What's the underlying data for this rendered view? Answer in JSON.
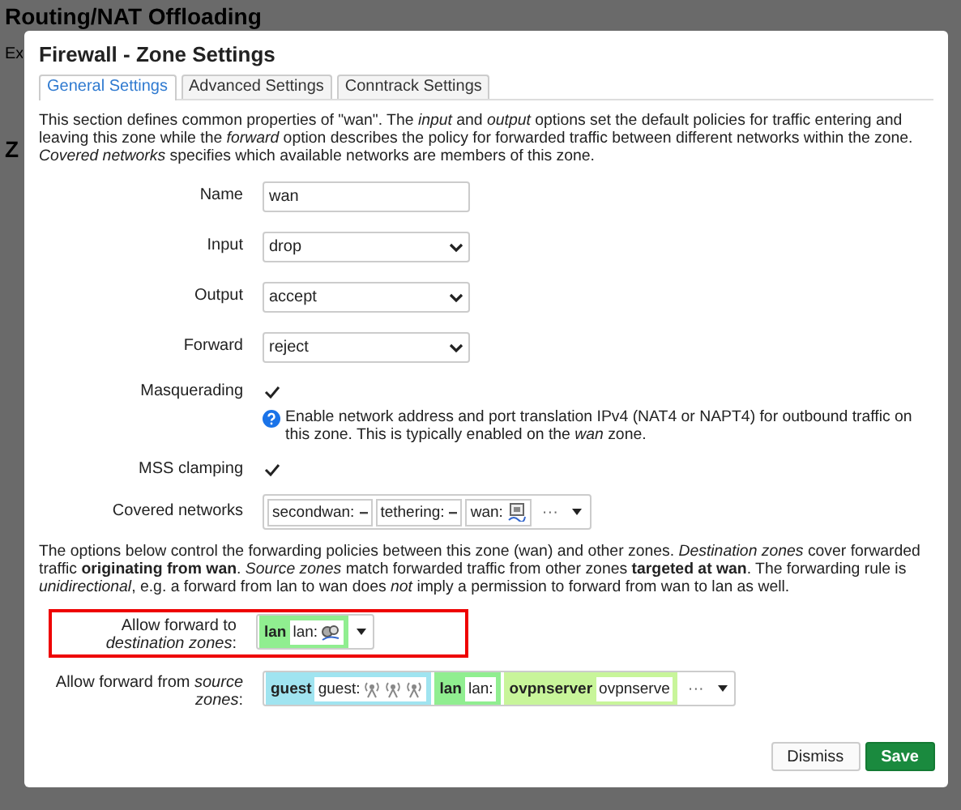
{
  "background": {
    "heading": "Routing/NAT Offloading",
    "intro": "Ex",
    "section": "Z"
  },
  "modal": {
    "title": "Firewall - Zone Settings",
    "tabs": [
      {
        "label": "General Settings",
        "selected": true
      },
      {
        "label": "Advanced Settings",
        "selected": false
      },
      {
        "label": "Conntrack Settings",
        "selected": false
      }
    ],
    "description": "This section defines common properties of \"wan\". The *input* and *output* options set the default policies for traffic entering and leaving this zone while the *forward* option describes the policy for forwarded traffic between different networks within the zone. *Covered networks* specifies which available networks are members of this zone.",
    "fields": [
      {
        "kind": "text",
        "label": "Name",
        "value": "wan"
      },
      {
        "kind": "select",
        "label": "Input",
        "value": "drop"
      },
      {
        "kind": "select",
        "label": "Output",
        "value": "accept"
      },
      {
        "kind": "select",
        "label": "Forward",
        "value": "reject"
      },
      {
        "kind": "checkbox",
        "label": "Masquerading",
        "checked": true,
        "help": "Enable network address and port translation IPv4 (NAT4 or NAPT4) for outbound traffic on this zone. This is typically enabled on the *wan* zone."
      },
      {
        "kind": "checkbox",
        "label": "MSS clamping",
        "checked": true
      },
      {
        "kind": "networks",
        "label": "Covered networks",
        "chips": [
          {
            "text": "secondwan:",
            "kind": "dash"
          },
          {
            "text": "tethering:",
            "kind": "dash"
          },
          {
            "text": "wan:",
            "kind": "device"
          }
        ],
        "more": "···"
      }
    ],
    "forwarding_description": "The options below control the forwarding policies between this zone (wan) and other zones. *Destination zones* cover forwarded traffic **originating from wan**. *Source zones* match forwarded traffic from other zones **targeted at wan**. The forwarding rule is *unidirectional*, e.g. a forward from lan to wan does *not* imply a permission to forward from wan to lan as well.",
    "forward_fields": [
      {
        "label": "Allow forward to *destination zones*:",
        "highlighted": true,
        "zones": [
          {
            "name": "lan",
            "color": "#90ee90",
            "detail": "lan:",
            "devices": [
              {
                "kind": "network"
              }
            ]
          }
        ]
      },
      {
        "label": "Allow forward from *source zones*:",
        "highlighted": false,
        "zones": [
          {
            "name": "guest",
            "color": "#a0e4f0",
            "detail": "guest:",
            "devices": [
              {
                "kind": "wireless"
              },
              {
                "kind": "wireless"
              },
              {
                "kind": "wireless"
              }
            ]
          },
          {
            "name": "lan",
            "color": "#90ee90",
            "detail": "lan:"
          },
          {
            "name": "ovpnserver",
            "color": "#c8f59a",
            "detail": "ovpnserve"
          }
        ],
        "more": "···"
      }
    ],
    "buttons": [
      {
        "label": "Dismiss",
        "kind": "secondary"
      },
      {
        "label": "Save",
        "kind": "primary"
      }
    ]
  }
}
